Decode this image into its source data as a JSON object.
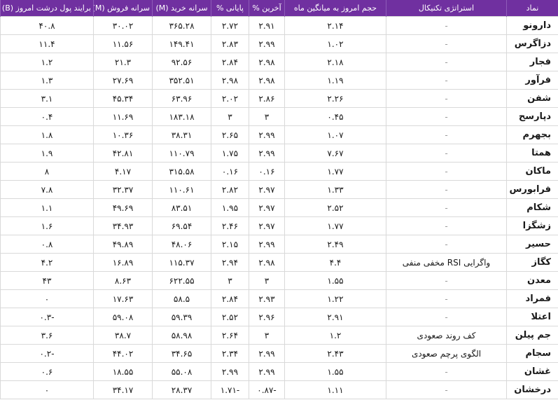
{
  "headers": {
    "symbol": "نماد",
    "strategy": "استراتژی تکنیکال",
    "volume_ratio": "حجم امروز به میانگین ماه",
    "last_pct": "آخرین %",
    "close_pct": "پایانی %",
    "buy_per_capita": "سرانه خرید (M)",
    "sell_per_capita": "سرانه فروش (M)",
    "money_flow": "برایند پول درشت امروز (B)"
  },
  "rows": [
    {
      "symbol": "دارونو",
      "strategy": "-",
      "volume_ratio": "۲.۱۴",
      "last_pct": "۲.۹۱",
      "close_pct": "۲.۷۲",
      "buy": "۳۶۵.۲۸",
      "sell": "۳۰.۰۲",
      "flow": "۴۰.۸"
    },
    {
      "symbol": "دزاگرس",
      "strategy": "-",
      "volume_ratio": "۱.۰۲",
      "last_pct": "۲.۹۹",
      "close_pct": "۲.۸۳",
      "buy": "۱۴۹.۴۱",
      "sell": "۱۱.۵۶",
      "flow": "۱۱.۴"
    },
    {
      "symbol": "فجار",
      "strategy": "-",
      "volume_ratio": "۲.۱۸",
      "last_pct": "۲.۹۸",
      "close_pct": "۲.۸۴",
      "buy": "۹۲.۵۶",
      "sell": "۲۱.۳",
      "flow": "۱.۲"
    },
    {
      "symbol": "فرآور",
      "strategy": "-",
      "volume_ratio": "۱.۱۹",
      "last_pct": "۲.۹۸",
      "close_pct": "۲.۹۸",
      "buy": "۳۵۲.۵۱",
      "sell": "۲۷.۶۹",
      "flow": "۱.۳"
    },
    {
      "symbol": "شفن",
      "strategy": "-",
      "volume_ratio": "۲.۲۶",
      "last_pct": "۲.۸۶",
      "close_pct": "۲.۰۲",
      "buy": "۶۳.۹۶",
      "sell": "۴۵.۳۴",
      "flow": "۳.۱"
    },
    {
      "symbol": "دپارسح",
      "strategy": "-",
      "volume_ratio": "۰.۴۵",
      "last_pct": "۳",
      "close_pct": "۳",
      "buy": "۱۸۳.۱۸",
      "sell": "۱۱.۶۹",
      "flow": "۰.۴"
    },
    {
      "symbol": "بجهرم",
      "strategy": "-",
      "volume_ratio": "۱.۰۷",
      "last_pct": "۲.۹۹",
      "close_pct": "۲.۶۵",
      "buy": "۳۸.۳۱",
      "sell": "۱۰.۳۶",
      "flow": "۱.۸"
    },
    {
      "symbol": "همتا",
      "strategy": "-",
      "volume_ratio": "۷.۶۷",
      "last_pct": "۲.۹۹",
      "close_pct": "۱.۷۵",
      "buy": "۱۱۰.۷۹",
      "sell": "۴۲.۸۱",
      "flow": "۱.۹"
    },
    {
      "symbol": "ماکان",
      "strategy": "-",
      "volume_ratio": "۱.۷۷",
      "last_pct": "۰.۱۶",
      "close_pct": "۰.۱۶",
      "buy": "۳۱۵.۵۸",
      "sell": "۴.۱۷",
      "flow": "۸"
    },
    {
      "symbol": "فرابورس",
      "strategy": "-",
      "volume_ratio": "۱.۳۳",
      "last_pct": "۲.۹۷",
      "close_pct": "۲.۸۲",
      "buy": "۱۱۰.۶۱",
      "sell": "۳۲.۳۷",
      "flow": "۷.۸"
    },
    {
      "symbol": "شکام",
      "strategy": "-",
      "volume_ratio": "۲.۵۲",
      "last_pct": "۲.۹۷",
      "close_pct": "۱.۹۵",
      "buy": "۸۳.۵۱",
      "sell": "۴۹.۶۹",
      "flow": "۱.۱"
    },
    {
      "symbol": "زشگزا",
      "strategy": "-",
      "volume_ratio": "۱.۷۷",
      "last_pct": "۲.۹۷",
      "close_pct": "۲.۴۶",
      "buy": "۶۹.۵۴",
      "sell": "۳۴.۹۳",
      "flow": "۱.۶"
    },
    {
      "symbol": "حسیر",
      "strategy": "-",
      "volume_ratio": "۲.۴۹",
      "last_pct": "۲.۹۹",
      "close_pct": "۲.۱۵",
      "buy": "۴۸.۰۶",
      "sell": "۴۹.۸۹",
      "flow": "۰.۸"
    },
    {
      "symbol": "کگاز",
      "strategy": "واگرایی RSI مخفی منفی",
      "volume_ratio": "۴.۴",
      "last_pct": "۲.۹۸",
      "close_pct": "۲.۹۴",
      "buy": "۱۱۵.۳۷",
      "sell": "۱۶.۸۹",
      "flow": "۴.۲"
    },
    {
      "symbol": "معدن",
      "strategy": "-",
      "volume_ratio": "۱.۵۵",
      "last_pct": "۳",
      "close_pct": "۳",
      "buy": "۶۲۲.۵۵",
      "sell": "۸.۶۳",
      "flow": "۴۳"
    },
    {
      "symbol": "فمراد",
      "strategy": "-",
      "volume_ratio": "۱.۲۲",
      "last_pct": "۲.۹۳",
      "close_pct": "۲.۸۴",
      "buy": "۵۸.۵",
      "sell": "۱۷.۶۳",
      "flow": "۰"
    },
    {
      "symbol": "اعتلا",
      "strategy": "-",
      "volume_ratio": "۲.۹۱",
      "last_pct": "۲.۹۶",
      "close_pct": "۲.۵۲",
      "buy": "۵۹.۳۹",
      "sell": "۵۹.۰۸",
      "flow": "-۰.۳"
    },
    {
      "symbol": "جم پیلن",
      "strategy": "کف روند صعودی",
      "volume_ratio": "۱.۲",
      "last_pct": "۳",
      "close_pct": "۲.۶۴",
      "buy": "۵۸.۹۸",
      "sell": "۳۸.۷",
      "flow": "۳.۶"
    },
    {
      "symbol": "سجام",
      "strategy": "الگوی پرچم صعودی",
      "volume_ratio": "۲.۴۳",
      "last_pct": "۲.۹۹",
      "close_pct": "۲.۳۴",
      "buy": "۳۴.۶۵",
      "sell": "۴۴.۰۲",
      "flow": "-۰.۲"
    },
    {
      "symbol": "غشان",
      "strategy": "-",
      "volume_ratio": "۱.۵۵",
      "last_pct": "۲.۹۹",
      "close_pct": "۲.۹۹",
      "buy": "۵۵.۰۸",
      "sell": "۱۸.۵۵",
      "flow": "۰.۶"
    },
    {
      "symbol": "درخشان",
      "strategy": "-",
      "volume_ratio": "۱.۱۱",
      "last_pct": "-۰.۸۷",
      "close_pct": "-۱.۷۱",
      "buy": "۲۸.۳۷",
      "sell": "۳۴.۱۷",
      "flow": "۰"
    }
  ]
}
